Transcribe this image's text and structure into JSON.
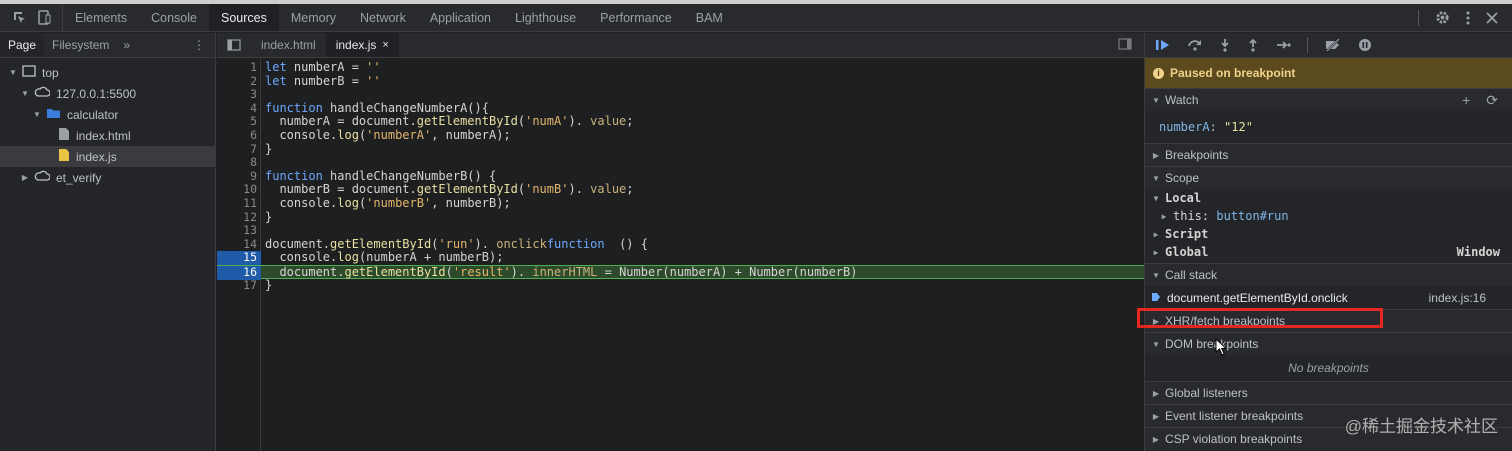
{
  "toolbar": {
    "tabs": [
      {
        "label": "Elements"
      },
      {
        "label": "Console"
      },
      {
        "label": "Sources"
      },
      {
        "label": "Memory"
      },
      {
        "label": "Network"
      },
      {
        "label": "Application"
      },
      {
        "label": "Lighthouse"
      },
      {
        "label": "Performance"
      },
      {
        "label": "BAM"
      }
    ],
    "active_tab": "Sources",
    "icons": [
      "inspect-icon",
      "device-toggle-icon",
      "settings-icon",
      "more-icon",
      "close-icon"
    ]
  },
  "navigator": {
    "tabs": [
      {
        "label": "Page"
      },
      {
        "label": "Filesystem"
      }
    ],
    "more": "»",
    "menu": "⋮",
    "tree": [
      {
        "label": "top",
        "icon": "frame-icon"
      },
      {
        "label": "127.0.0.1:5500",
        "icon": "cloud-icon"
      },
      {
        "label": "calculator",
        "icon": "folder-icon"
      },
      {
        "label": "index.html",
        "icon": "file-icon"
      },
      {
        "label": "index.js",
        "icon": "js-file-icon"
      },
      {
        "label": "et_verify",
        "icon": "cloud-icon"
      }
    ]
  },
  "editor": {
    "tabs": [
      {
        "label": "index.html"
      },
      {
        "label": "index.js",
        "close": "×"
      }
    ],
    "lines": [
      {
        "n": "1",
        "parts": [
          [
            "k",
            "let"
          ],
          [
            "",
            "numberA = "
          ],
          [
            "s",
            "''"
          ]
        ]
      },
      {
        "n": "2",
        "parts": [
          [
            "k",
            "let"
          ],
          [
            "",
            "numberB = "
          ],
          [
            "s",
            "''"
          ]
        ]
      },
      {
        "n": "3",
        "parts": []
      },
      {
        "n": "4",
        "parts": [
          [
            "k",
            "function"
          ],
          [
            "",
            "handleChangeNumberA(){"
          ]
        ]
      },
      {
        "n": "5",
        "parts": [
          [
            "",
            "  numberA = document."
          ],
          [
            "f",
            "getElementById"
          ],
          [
            "",
            "("
          ],
          [
            "s",
            "'numA'"
          ],
          [
            "",
            "). "
          ],
          [
            "m",
            "value"
          ],
          [
            "",
            ";"
          ]
        ]
      },
      {
        "n": "6",
        "parts": [
          [
            "",
            "  console."
          ],
          [
            "f",
            "log"
          ],
          [
            "",
            "("
          ],
          [
            "s",
            "'numberA'"
          ],
          [
            "",
            ", numberA);"
          ]
        ]
      },
      {
        "n": "7",
        "parts": [
          [
            "",
            "}"
          ]
        ]
      },
      {
        "n": "8",
        "parts": []
      },
      {
        "n": "9",
        "parts": [
          [
            "k",
            "function"
          ],
          [
            "",
            "handleChangeNumberB() {"
          ]
        ]
      },
      {
        "n": "10",
        "parts": [
          [
            "",
            "  numberB = document."
          ],
          [
            "f",
            "getElementById"
          ],
          [
            "",
            "("
          ],
          [
            "s",
            "'numB'"
          ],
          [
            "",
            "). "
          ],
          [
            "m",
            "value"
          ],
          [
            "",
            ";"
          ]
        ]
      },
      {
        "n": "11",
        "parts": [
          [
            "",
            "  console."
          ],
          [
            "f",
            "log"
          ],
          [
            "",
            "("
          ],
          [
            "s",
            "'numberB'"
          ],
          [
            "",
            ", numberB);"
          ]
        ]
      },
      {
        "n": "12",
        "parts": [
          [
            "",
            "}"
          ]
        ]
      },
      {
        "n": "13",
        "parts": []
      },
      {
        "n": "14",
        "parts": [
          [
            "",
            "document."
          ],
          [
            "f",
            "getElementById"
          ],
          [
            "",
            "("
          ],
          [
            "s",
            "'run'"
          ],
          [
            "",
            "). "
          ],
          [
            "m",
            "onclick"
          ],
          [
            "",
            "",
            " = "
          ],
          [
            "k",
            "function"
          ],
          [
            "",
            " () {"
          ]
        ]
      },
      {
        "n": "15",
        "parts": [
          [
            "",
            "  console."
          ],
          [
            "f",
            "log"
          ],
          [
            "",
            "(numberA + numberB);"
          ]
        ]
      },
      {
        "n": "16",
        "parts": [
          [
            "",
            "  document."
          ],
          [
            "f",
            "getElementById"
          ],
          [
            "",
            "("
          ],
          [
            "s",
            "'result'"
          ],
          [
            "",
            "). "
          ],
          [
            "m",
            "innerHTML"
          ],
          [
            "",
            " = Number(numberA) + Number(numberB)"
          ]
        ]
      },
      {
        "n": "17",
        "parts": [
          [
            "",
            "}"
          ]
        ]
      }
    ]
  },
  "debugger": {
    "paused_label": "Paused on breakpoint",
    "watch": {
      "title": "Watch",
      "expr_name": "numberA",
      "expr_value": "\"12\""
    },
    "sections": {
      "breakpoints": "Breakpoints",
      "scope": "Scope",
      "local": "Local",
      "this_key": "this",
      "this_value": "button#run",
      "script": "Script",
      "global": "Global",
      "global_value": "Window",
      "call_stack": "Call stack",
      "frame_name": "document.getElementById.onclick",
      "frame_loc": "index.js:16",
      "xhr": "XHR/fetch breakpoints",
      "dom": "DOM breakpoints",
      "no_breakpoints": "No breakpoints",
      "global_listeners": "Global listeners",
      "event_listener": "Event listener breakpoints",
      "csp": "CSP violation breakpoints"
    }
  },
  "watermark": "@稀土掘金技术社区",
  "colors": {
    "highlight": "#e5281f",
    "paused": "#5a4a1d",
    "accent": "#1f5ba8"
  }
}
